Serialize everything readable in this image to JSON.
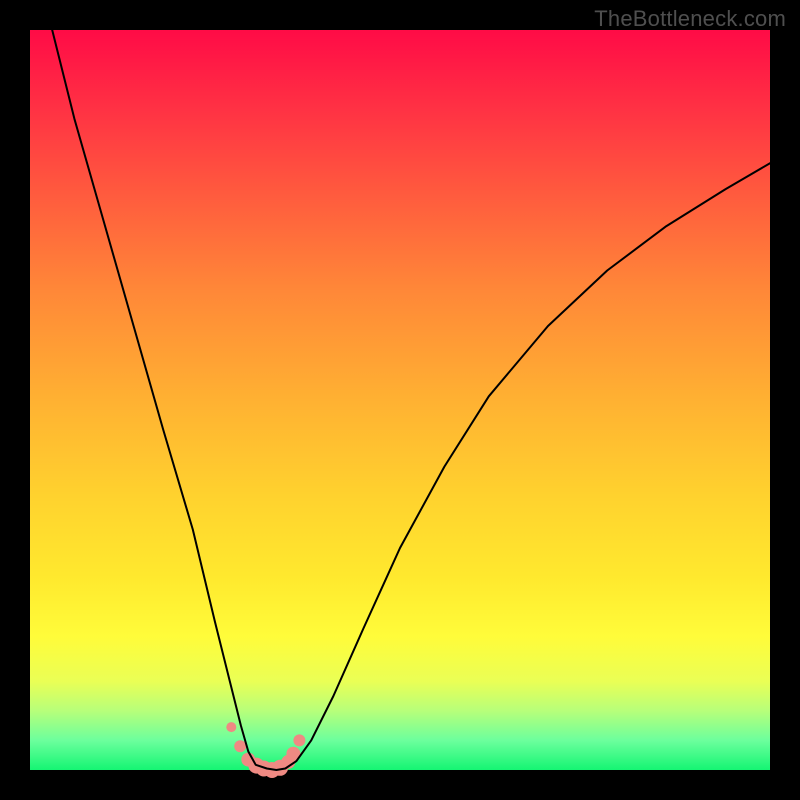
{
  "watermark": "TheBottleneck.com",
  "chart_data": {
    "type": "line",
    "title": "",
    "xlabel": "",
    "ylabel": "",
    "xlim": [
      0,
      100
    ],
    "ylim": [
      0,
      100
    ],
    "series": [
      {
        "name": "curve",
        "x": [
          3,
          6,
          10,
          14,
          18,
          22,
          25,
          27,
          28.5,
          29.5,
          30.5,
          32,
          33.3,
          34.5,
          36,
          38,
          41,
          45,
          50,
          56,
          62,
          70,
          78,
          86,
          94,
          100
        ],
        "y_pct": [
          100,
          88,
          74,
          60,
          46,
          32.5,
          20,
          12,
          6,
          2.5,
          0.7,
          0.2,
          0.0,
          0.2,
          1.2,
          4,
          10,
          19,
          30,
          41,
          50.5,
          60,
          67.5,
          73.5,
          78.5,
          82
        ]
      }
    ],
    "markers": {
      "color": "#ef8a83",
      "points_x": [
        27.2,
        28.4,
        29.5,
        30.6,
        31.6,
        32.7,
        33.8,
        34.9,
        35.6,
        36.4
      ],
      "points_y_pct": [
        5.8,
        3.2,
        1.4,
        0.6,
        0.2,
        0.0,
        0.3,
        1.1,
        2.2,
        4.0
      ],
      "radii": [
        5,
        6,
        7,
        8,
        8,
        8,
        8,
        7,
        7,
        6
      ]
    }
  }
}
